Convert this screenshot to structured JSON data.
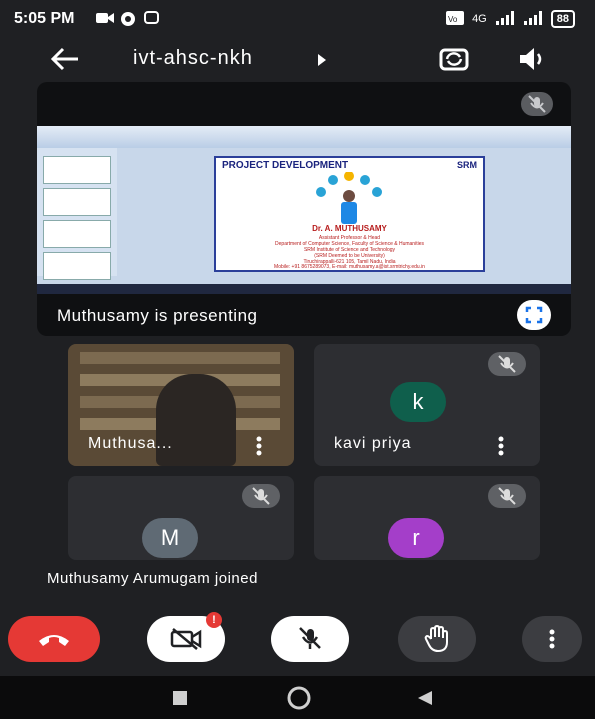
{
  "status_bar": {
    "time": "5:05 PM",
    "network": "4G",
    "battery": "88"
  },
  "header": {
    "meeting_code": "ivt-ahsc-nkh",
    "icons": [
      "back-arrow-icon",
      "switch-camera-icon",
      "speaker-icon"
    ]
  },
  "presentation": {
    "presenting_label": "Muthusamy is presenting",
    "slide": {
      "title": "PROJECT DEVELOPMENT",
      "logo": "SRM",
      "presenter_name": "Dr. A. MUTHUSAMY",
      "lines": [
        "Assistant Professor & Head",
        "Department of Computer Science, Faculty of Science & Humanities",
        "SRM Institute of Science and Technology",
        "(SRM Deemed to be University)",
        "Tiruchirappalli-621 105, Tamil Nadu, India",
        "Mobile: +91 8675289073, E-mail: muthusamy.a@ist.srmtrichy.edu.in"
      ]
    }
  },
  "participants": [
    {
      "name": "Muthusa...",
      "type": "video"
    },
    {
      "name": "kavi priya",
      "initial": "k",
      "avatar_color": "#0f5f4c",
      "muted": true
    },
    {
      "name": "",
      "initial": "M",
      "avatar_color": "#5f6a74",
      "muted": true
    },
    {
      "name": "",
      "initial": "r",
      "avatar_color": "#a43ec9",
      "muted": true
    }
  ],
  "notification": {
    "text": "Muthusamy Arumugam joined"
  },
  "controls": {
    "alert_badge": "!",
    "buttons": [
      "end-call",
      "camera-off",
      "mic-off",
      "raise-hand",
      "more-options"
    ]
  },
  "colors": {
    "end_call": "#e53935",
    "background": "#1f2023",
    "tile": "#2d2e32"
  }
}
